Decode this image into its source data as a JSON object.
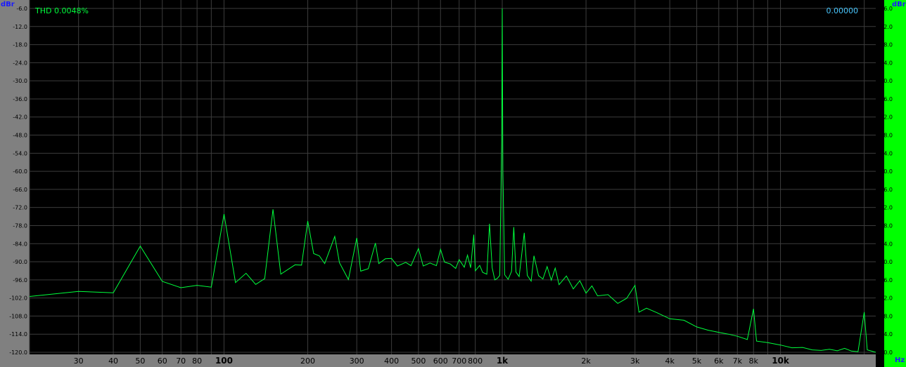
{
  "left_axis": {
    "unit": "dBr"
  },
  "right_axis": {
    "unit": "dBr",
    "color": "#00ff00"
  },
  "x_axis": {
    "unit": "Hz"
  },
  "thd_label": "THD 0.0048%",
  "readout": "0.00000",
  "colors": {
    "background": "#000000",
    "trace": "#00ff3c",
    "grid": "#3c3c3c",
    "panel": "#808080",
    "axis_unit": "#1a1aff",
    "readout": "#4ac8ff"
  },
  "chart_data": {
    "type": "line",
    "x_scale": "log",
    "xlim": [
      20,
      22000
    ],
    "ylim": [
      -120,
      -6
    ],
    "grid": true,
    "yticks": [
      -6.0,
      -12.0,
      -18.0,
      -24.0,
      -30.0,
      -36.0,
      -42.0,
      -48.0,
      -54.0,
      -60.0,
      -66.0,
      -72.0,
      -78.0,
      -84.0,
      -90.0,
      -96.0,
      -102.0,
      -108.0,
      -114.0,
      -120.0
    ],
    "ytick_labels": [
      "-6.0",
      "-12.0",
      "-18.0",
      "-24.0",
      "-30.0",
      "-36.0",
      "-42.0",
      "-48.0",
      "-54.0",
      "-60.0",
      "-66.0",
      "-72.0",
      "-78.0",
      "-84.0",
      "-90.0",
      "-96.0",
      "-102.0",
      "-108.0",
      "-114.0",
      "-120.0"
    ],
    "xticks": [
      {
        "f": 30,
        "label": "30",
        "major": false
      },
      {
        "f": 40,
        "label": "40",
        "major": false
      },
      {
        "f": 50,
        "label": "50",
        "major": false
      },
      {
        "f": 60,
        "label": "60",
        "major": false
      },
      {
        "f": 70,
        "label": "70",
        "major": false
      },
      {
        "f": 80,
        "label": "80",
        "major": false
      },
      {
        "f": 100,
        "label": "100",
        "major": true
      },
      {
        "f": 200,
        "label": "200",
        "major": false
      },
      {
        "f": 300,
        "label": "300",
        "major": false
      },
      {
        "f": 400,
        "label": "400",
        "major": false
      },
      {
        "f": 500,
        "label": "500",
        "major": false
      },
      {
        "f": 600,
        "label": "600",
        "major": false
      },
      {
        "f": 700,
        "label": "700",
        "major": false
      },
      {
        "f": 800,
        "label": "800",
        "major": false
      },
      {
        "f": 1000,
        "label": "1k",
        "major": true
      },
      {
        "f": 2000,
        "label": "2k",
        "major": false
      },
      {
        "f": 3000,
        "label": "3k",
        "major": false
      },
      {
        "f": 4000,
        "label": "4k",
        "major": false
      },
      {
        "f": 5000,
        "label": "5k",
        "major": false
      },
      {
        "f": 6000,
        "label": "6k",
        "major": false
      },
      {
        "f": 7000,
        "label": "7k",
        "major": false
      },
      {
        "f": 8000,
        "label": "8k",
        "major": false
      },
      {
        "f": 10000,
        "label": "10k",
        "major": true
      }
    ],
    "extra_vgrid": [
      20,
      90,
      9000,
      20000
    ],
    "series": [
      {
        "color": "#00ff3c",
        "points": [
          [
            20,
            -101.5
          ],
          [
            30,
            -99.8
          ],
          [
            40,
            -100.3
          ],
          [
            50,
            -84.8
          ],
          [
            60,
            -96.5
          ],
          [
            70,
            -98.6
          ],
          [
            80,
            -97.8
          ],
          [
            90,
            -98.4
          ],
          [
            100,
            -74.2
          ],
          [
            110,
            -96.9
          ],
          [
            120,
            -93.8
          ],
          [
            130,
            -97.5
          ],
          [
            140,
            -95.6
          ],
          [
            150,
            -72.6
          ],
          [
            160,
            -94.1
          ],
          [
            180,
            -91.0
          ],
          [
            190,
            -91.1
          ],
          [
            200,
            -76.5
          ],
          [
            210,
            -87.3
          ],
          [
            220,
            -88.0
          ],
          [
            230,
            -90.6
          ],
          [
            250,
            -81.6
          ],
          [
            260,
            -90.3
          ],
          [
            280,
            -95.9
          ],
          [
            300,
            -82.1
          ],
          [
            310,
            -93.1
          ],
          [
            330,
            -92.3
          ],
          [
            350,
            -83.8
          ],
          [
            360,
            -90.6
          ],
          [
            380,
            -89.0
          ],
          [
            400,
            -88.9
          ],
          [
            420,
            -91.4
          ],
          [
            450,
            -90.2
          ],
          [
            470,
            -91.3
          ],
          [
            500,
            -85.6
          ],
          [
            520,
            -91.4
          ],
          [
            550,
            -90.4
          ],
          [
            580,
            -91.3
          ],
          [
            600,
            -85.9
          ],
          [
            620,
            -90.1
          ],
          [
            650,
            -90.7
          ],
          [
            680,
            -92.2
          ],
          [
            700,
            -89.3
          ],
          [
            730,
            -91.8
          ],
          [
            750,
            -87.8
          ],
          [
            770,
            -92.0
          ],
          [
            790,
            -81.0
          ],
          [
            800,
            -93.0
          ],
          [
            830,
            -91.2
          ],
          [
            850,
            -93.5
          ],
          [
            880,
            -94.1
          ],
          [
            900,
            -77.4
          ],
          [
            920,
            -92.0
          ],
          [
            940,
            -96.0
          ],
          [
            960,
            -95.5
          ],
          [
            980,
            -94.5
          ],
          [
            995,
            -50.0
          ],
          [
            1000,
            -6.0
          ],
          [
            1005,
            -60.0
          ],
          [
            1020,
            -94.3
          ],
          [
            1050,
            -95.8
          ],
          [
            1080,
            -93.2
          ],
          [
            1100,
            -78.5
          ],
          [
            1120,
            -93.4
          ],
          [
            1150,
            -94.9
          ],
          [
            1200,
            -80.4
          ],
          [
            1230,
            -94.5
          ],
          [
            1270,
            -96.4
          ],
          [
            1300,
            -88.0
          ],
          [
            1350,
            -94.6
          ],
          [
            1400,
            -95.7
          ],
          [
            1450,
            -91.6
          ],
          [
            1500,
            -96.1
          ],
          [
            1550,
            -92.1
          ],
          [
            1600,
            -97.6
          ],
          [
            1700,
            -94.7
          ],
          [
            1800,
            -99.0
          ],
          [
            1900,
            -96.3
          ],
          [
            2000,
            -100.4
          ],
          [
            2100,
            -98.0
          ],
          [
            2200,
            -101.3
          ],
          [
            2400,
            -100.9
          ],
          [
            2600,
            -103.8
          ],
          [
            2800,
            -102.1
          ],
          [
            3000,
            -97.8
          ],
          [
            3100,
            -106.7
          ],
          [
            3300,
            -105.4
          ],
          [
            3600,
            -106.9
          ],
          [
            4000,
            -108.9
          ],
          [
            4500,
            -109.4
          ],
          [
            5000,
            -111.6
          ],
          [
            5500,
            -112.7
          ],
          [
            6000,
            -113.4
          ],
          [
            6500,
            -114.0
          ],
          [
            7000,
            -114.7
          ],
          [
            7600,
            -115.8
          ],
          [
            8000,
            -105.6
          ],
          [
            8200,
            -116.3
          ],
          [
            9000,
            -116.8
          ],
          [
            10000,
            -117.6
          ],
          [
            11000,
            -118.5
          ],
          [
            12000,
            -118.4
          ],
          [
            13000,
            -119.2
          ],
          [
            14000,
            -119.4
          ],
          [
            15000,
            -119.0
          ],
          [
            16000,
            -119.5
          ],
          [
            17000,
            -118.7
          ],
          [
            18000,
            -119.6
          ],
          [
            19000,
            -119.8
          ],
          [
            20000,
            -106.7
          ],
          [
            20500,
            -119.2
          ],
          [
            22000,
            -120.0
          ]
        ]
      }
    ]
  }
}
